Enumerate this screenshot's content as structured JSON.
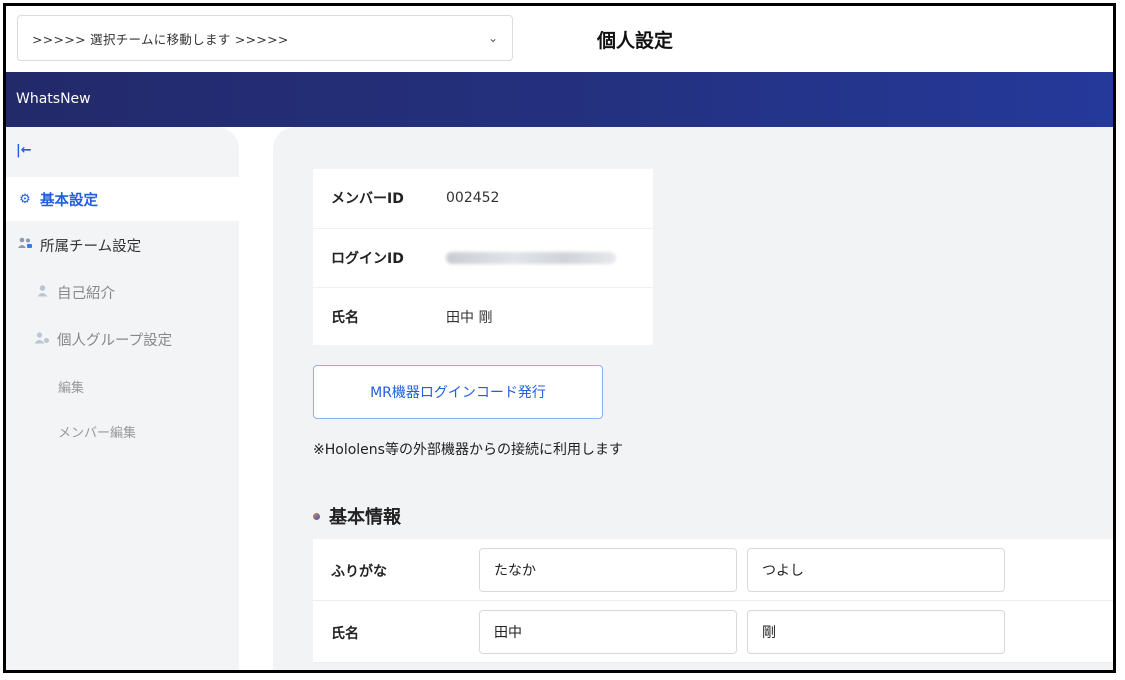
{
  "header": {
    "team_select_value": ">>>>> 選択チームに移動します >>>>>",
    "page_title": "個人設定"
  },
  "appbar": {
    "app_name": "WhatsNew"
  },
  "sidebar": {
    "collapse_icon": "|←",
    "items": [
      {
        "label": "基本設定",
        "icon": "gear-icon",
        "active": true
      },
      {
        "label": "所属チーム設定",
        "icon": "team-icon"
      },
      {
        "label": "自己紹介",
        "icon": "person-icon"
      },
      {
        "label": "個人グループ設定",
        "icon": "group-settings-icon"
      },
      {
        "label": "編集"
      },
      {
        "label": "メンバー編集"
      }
    ]
  },
  "account": {
    "member_id_label": "メンバーID",
    "member_id_value": "002452",
    "login_id_label": "ログインID",
    "name_label": "氏名",
    "name_value": "田中 剛"
  },
  "mr_button_label": "MR機器ログインコード発行",
  "note": "※Hololens等の外部機器からの接続に利用します",
  "basic_info": {
    "title": "基本情報",
    "furigana_label": "ふりがな",
    "furigana_last": "たなか",
    "furigana_first": "つよし",
    "name_label": "氏名",
    "name_last": "田中",
    "name_first": "剛"
  },
  "colors": {
    "accent": "#1f5fe0",
    "appbar": "#243180",
    "sidebar_bg": "#f3f4f6",
    "main_bg": "#f2f3f5"
  }
}
